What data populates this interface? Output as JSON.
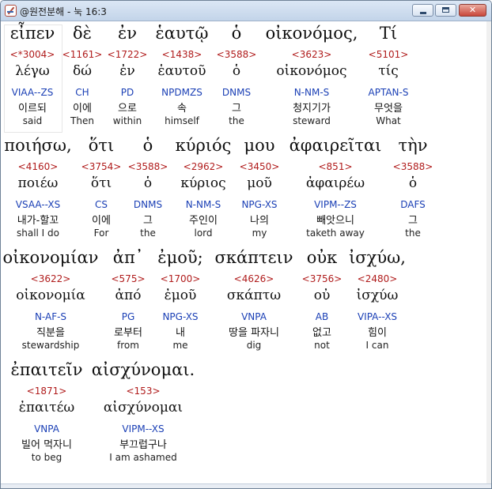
{
  "window": {
    "title": "@원전분해 - 눅 16:3",
    "minimize_label": "",
    "maximize_label": "",
    "close_label": "✕"
  },
  "lines": [
    {
      "words": [
        {
          "greek": "εἶπεν",
          "strongs": "<*3004>",
          "lemma": "λέγω",
          "morph": "VIAA--ZS",
          "korean": "이르되",
          "english": "said"
        },
        {
          "greek": "δὲ",
          "strongs": "<1161>",
          "lemma": "δώ",
          "morph": "CH",
          "korean": "이에",
          "english": "Then"
        },
        {
          "greek": "ἐν",
          "strongs": "<1722>",
          "lemma": "ἐν",
          "morph": "PD",
          "korean": "으로",
          "english": "within"
        },
        {
          "greek": "ἑαυτῷ",
          "strongs": "<1438>",
          "lemma": "ἑαυτοῦ",
          "morph": "NPDMZS",
          "korean": "속",
          "english": "himself"
        },
        {
          "greek": "ὁ",
          "strongs": "<3588>",
          "lemma": "ὁ",
          "morph": "DNMS",
          "korean": "그",
          "english": "the"
        },
        {
          "greek": "οἰκονόμος,",
          "strongs": "<3623>",
          "lemma": "οἰκονόμος",
          "morph": "N-NM-S",
          "korean": "청지기가",
          "english": "steward"
        },
        {
          "greek": "Τί",
          "strongs": "<5101>",
          "lemma": "τίς",
          "morph": "APTAN-S",
          "korean": "무엇을",
          "english": "What"
        }
      ]
    },
    {
      "words": [
        {
          "greek": "ποιήσω,",
          "strongs": "<4160>",
          "lemma": "ποιέω",
          "morph": "VSAA--XS",
          "korean": "내가-할꼬",
          "english": "shall I do"
        },
        {
          "greek": "ὅτι",
          "strongs": "<3754>",
          "lemma": "ὅτι",
          "morph": "CS",
          "korean": "이에",
          "english": "For"
        },
        {
          "greek": "ὁ",
          "strongs": "<3588>",
          "lemma": "ὁ",
          "morph": "DNMS",
          "korean": "그",
          "english": "the"
        },
        {
          "greek": "κύριός",
          "strongs": "<2962>",
          "lemma": "κύριος",
          "morph": "N-NM-S",
          "korean": "주인이",
          "english": "lord"
        },
        {
          "greek": "μου",
          "strongs": "<3450>",
          "lemma": "μοῦ",
          "morph": "NPG-XS",
          "korean": "나의",
          "english": "my"
        },
        {
          "greek": "ἀφαιρεῖται",
          "strongs": "<851>",
          "lemma": "ἀφαιρέω",
          "morph": "VIPM--ZS",
          "korean": "빼앗으니",
          "english": "taketh away"
        },
        {
          "greek": "τὴν",
          "strongs": "<3588>",
          "lemma": "ὁ",
          "morph": "DAFS",
          "korean": "그",
          "english": "the"
        }
      ]
    },
    {
      "words": [
        {
          "greek": "οἰκονομίαν",
          "strongs": "<3622>",
          "lemma": "οἰκονομία",
          "morph": "N-AF-S",
          "korean": "직분을",
          "english": "stewardship"
        },
        {
          "greek": "ἀπ᾽",
          "strongs": "<575>",
          "lemma": "ἀπό",
          "morph": "PG",
          "korean": "로부터",
          "english": "from"
        },
        {
          "greek": "ἐμοῦ;",
          "strongs": "<1700>",
          "lemma": "ἐμοῦ",
          "morph": "NPG-XS",
          "korean": "내",
          "english": "me"
        },
        {
          "greek": "σκάπτειν",
          "strongs": "<4626>",
          "lemma": "σκάπτω",
          "morph": "VNPA",
          "korean": "땅을 파자니",
          "english": "dig"
        },
        {
          "greek": "οὐκ",
          "strongs": "<3756>",
          "lemma": "οὐ",
          "morph": "AB",
          "korean": "없고",
          "english": "not"
        },
        {
          "greek": "ἰσχύω,",
          "strongs": "<2480>",
          "lemma": "ἰσχύω",
          "morph": "VIPA--XS",
          "korean": "힘이",
          "english": "I can"
        }
      ]
    },
    {
      "words": [
        {
          "greek": "ἐπαιτεῖν",
          "strongs": "<1871>",
          "lemma": "ἐπαιτέω",
          "morph": "VNPA",
          "korean": "빌어 먹자니",
          "english": "to beg"
        },
        {
          "greek": "αἰσχύνομαι.",
          "strongs": "<153>",
          "lemma": "αἰσχύνομαι",
          "morph": "VIPM--XS",
          "korean": "부끄럽구나",
          "english": "I am ashamed"
        }
      ]
    }
  ]
}
